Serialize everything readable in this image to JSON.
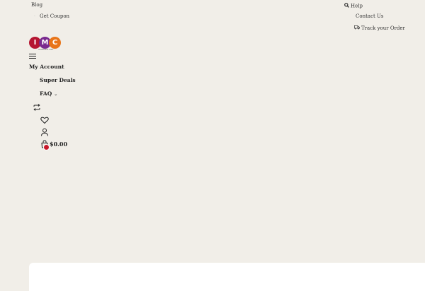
{
  "topbar": {
    "blog_label": "Blog",
    "get_coupon_label": "Get Coupon",
    "help_label": "Help",
    "contact_label": "Contact Us",
    "track_order_label": "Track your Order"
  },
  "logo": {
    "letters": [
      "I",
      "M",
      "C"
    ],
    "tagline": "imcdirect.com"
  },
  "nav": {
    "my_account_label": "My Account",
    "super_deals_label": "Super Deals",
    "faq_label": "FAQ"
  },
  "cart": {
    "total": "$0.00"
  },
  "colors": {
    "page_background": "#f1eee8",
    "logo_red": "#b51631",
    "logo_purple": "#7a2a8f",
    "logo_orange": "#e8751a",
    "cart_badge": "#c8182a"
  },
  "icons": {
    "help": "magnifier-icon",
    "track_order": "truck-icon",
    "menu": "hamburger-icon",
    "compare": "compare-arrows-icon",
    "wishlist": "heart-icon",
    "account": "user-icon",
    "cart": "shopping-bag-icon"
  }
}
